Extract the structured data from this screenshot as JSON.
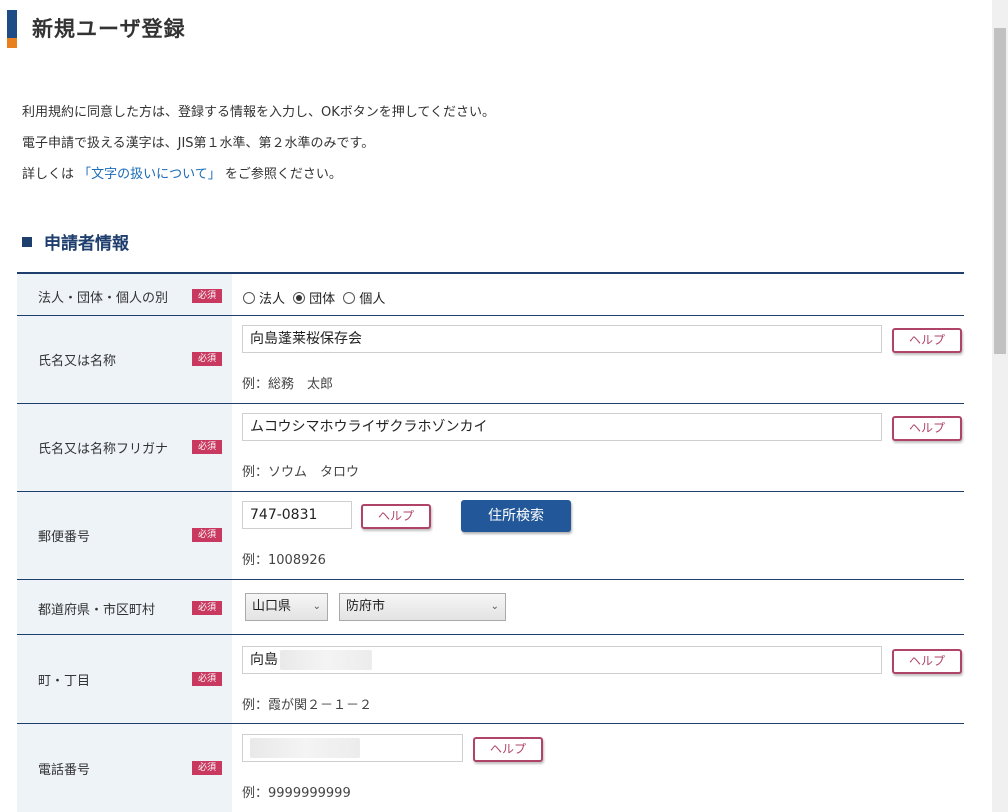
{
  "page": {
    "title": "新規ユーザ登録",
    "intro": [
      "利用規約に同意した方は、登録する情報を入力し、OKボタンを押してください。",
      "電子申請で扱える漢字は、JIS第１水準、第２水準のみです。"
    ],
    "intro3": {
      "prefix": "詳しくは",
      "link": "「文字の扱いについて」",
      "suffix": "をご参照ください。"
    },
    "section_title": "申請者情報"
  },
  "common": {
    "required": "必須",
    "help": "ヘルプ"
  },
  "form": {
    "entity_type": {
      "label": "法人・団体・個人の別",
      "options": [
        "法人",
        "団体",
        "個人"
      ],
      "selected": "団体"
    },
    "name": {
      "label": "氏名又は名称",
      "value": "向島蓬莱桜保存会",
      "example": "例：総務　太郎"
    },
    "name_kana": {
      "label": "氏名又は名称フリガナ",
      "value": "ムコウシマホウライザクラホゾンカイ",
      "example": "例：ソウム　タロウ"
    },
    "postal": {
      "label": "郵便番号",
      "value": "747-0831",
      "search_button": "住所検索",
      "example": "例：1008926"
    },
    "pref_city": {
      "label": "都道府県・市区町村",
      "prefecture": "山口県",
      "city": "防府市"
    },
    "town": {
      "label": "町・丁目",
      "value": "向島",
      "example": "例：霞が関２－１－２"
    },
    "phone": {
      "label": "電話番号",
      "value": "",
      "example": "例：9999999999"
    }
  }
}
